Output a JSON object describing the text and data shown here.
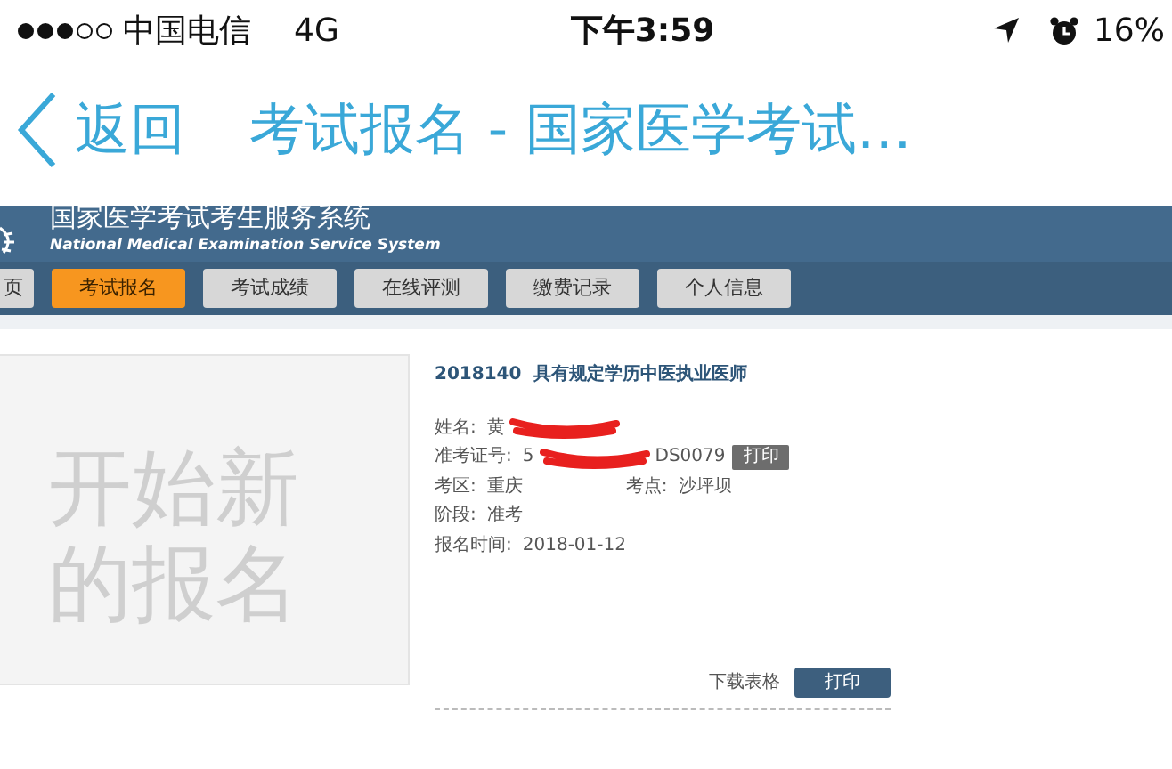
{
  "status_bar": {
    "carrier": "中国电信",
    "network": "4G",
    "time": "下午3:59",
    "battery": "16%"
  },
  "nav_bar": {
    "back": "返回",
    "title": "考试报名 - 国家医学考试…"
  },
  "site": {
    "title": "国家医学考试考生服务系统",
    "subtitle": "National Medical Examination Service System",
    "tabs": [
      {
        "label": "页",
        "selected": false
      },
      {
        "label": "考试报名",
        "selected": true
      },
      {
        "label": "考试成绩",
        "selected": false
      },
      {
        "label": "在线评测",
        "selected": false
      },
      {
        "label": "缴费记录",
        "selected": false
      },
      {
        "label": "个人信息",
        "selected": false
      }
    ]
  },
  "start_card": {
    "label": "开始新的报名"
  },
  "registration": {
    "code": "2018140",
    "category": "具有规定学历中医执业医师",
    "rows": [
      [
        {
          "label": "姓名:",
          "value": "黄",
          "redacted": true
        }
      ],
      [
        {
          "label": "准考证号:",
          "value": "5",
          "redacted": true,
          "value_after": "DS0079",
          "button": "打印"
        }
      ],
      [
        {
          "label": "考区:",
          "value": "重庆"
        },
        {
          "label": "考点:",
          "value": "沙坪坝"
        }
      ],
      [
        {
          "label": "阶段:",
          "value": "准考"
        }
      ],
      [
        {
          "label": "报名时间:",
          "value": "2018-01-12"
        }
      ]
    ],
    "download": "下载表格",
    "print": "打印"
  }
}
